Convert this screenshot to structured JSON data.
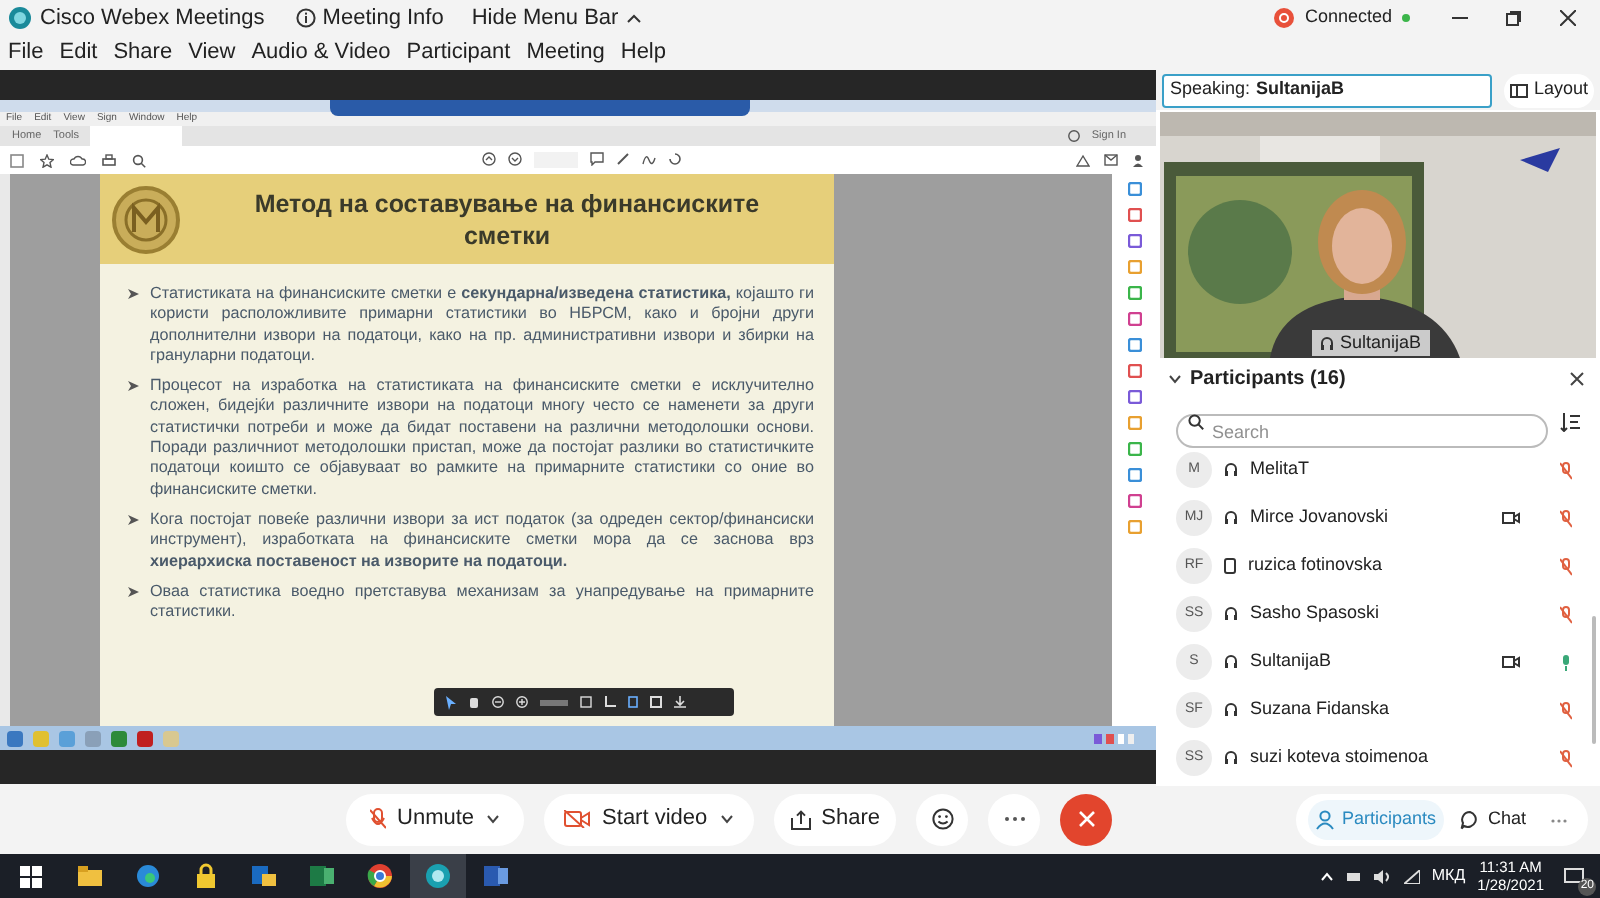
{
  "title_bar": {
    "app": "Cisco Webex Meetings",
    "meeting_info": "Meeting Info",
    "hide_menu": "Hide Menu Bar",
    "status": "Connected"
  },
  "menu": [
    "File",
    "Edit",
    "Share",
    "View",
    "Audio & Video",
    "Participant",
    "Meeting",
    "Help"
  ],
  "shared_screen": {
    "pdf_menu": [
      "File",
      "Edit",
      "View",
      "Sign",
      "Window",
      "Help"
    ],
    "pdf_tabs": [
      {
        "label": "Home",
        "selected": false
      },
      {
        "label": "Tools",
        "selected": false
      }
    ],
    "sign_in": "Sign In",
    "slide": {
      "title": "Метод на составување на финансиските сметки",
      "bullets": [
        "Статистиката на финансиските сметки е **секундарна/изведена статистика,** којашто ги користи расположливите примарни статистики во НБРСМ, како и бројни други дополнителни извори на податоци, како на пр. административни извори и збирки на грануларни податоци.",
        "Процесот на изработка на статистиката на финансиските сметки е исклучително сложен, бидејќи различните извори на податоци многу често се наменети за други статистички потреби и може да бидат поставени на различни методолошки основи. Поради различниот методолошки пристап, може да постојат разлики во статистичките податоци коишто се објавуваат во рамките на примарните статистики со оние во финансиските сметки.",
        "Кога постојат повеќе различни извори за ист податок (за одреден сектор/финансиски инструмент), изработката на финансиските сметки мора да се заснова врз **хиерархиска поставеност на изворите на податоци.**",
        "Оваа статистика воедно претставува механизам за унапредување на примарните статистики."
      ]
    }
  },
  "speaking": {
    "label": "Speaking:",
    "name": "SultanijaB"
  },
  "layout": "Layout",
  "video": {
    "name": "SultanijaB"
  },
  "participants": {
    "title": "Participants (16)",
    "search_placeholder": "Search",
    "items": [
      {
        "initials": "M",
        "name": "MelitaT",
        "kind": "computer",
        "video": false,
        "muted": true
      },
      {
        "initials": "MJ",
        "name": "Mirce Jovanovski",
        "kind": "computer",
        "video": true,
        "muted": true
      },
      {
        "initials": "RF",
        "name": "ruzica fotinovska",
        "kind": "phone",
        "video": false,
        "muted": true
      },
      {
        "initials": "SS",
        "name": "Sasho Spasoski",
        "kind": "computer",
        "video": false,
        "muted": true
      },
      {
        "initials": "S",
        "name": "SultanijaB",
        "kind": "computer",
        "video": true,
        "muted": false
      },
      {
        "initials": "SF",
        "name": "Suzana Fidanska",
        "kind": "computer",
        "video": false,
        "muted": true
      },
      {
        "initials": "SS",
        "name": "suzi kotevа stoimenoa",
        "kind": "computer",
        "video": false,
        "muted": true
      }
    ]
  },
  "panel_tabs": [
    {
      "label": "Participants",
      "selected": true
    },
    {
      "label": "Chat",
      "selected": false
    }
  ],
  "controls": {
    "unmute": "Unmute",
    "start_video": "Start video",
    "share": "Share"
  },
  "taskbar": {
    "lang": "МКД",
    "time": "11:31 AM",
    "date": "1/28/2021",
    "notifications": "20"
  }
}
